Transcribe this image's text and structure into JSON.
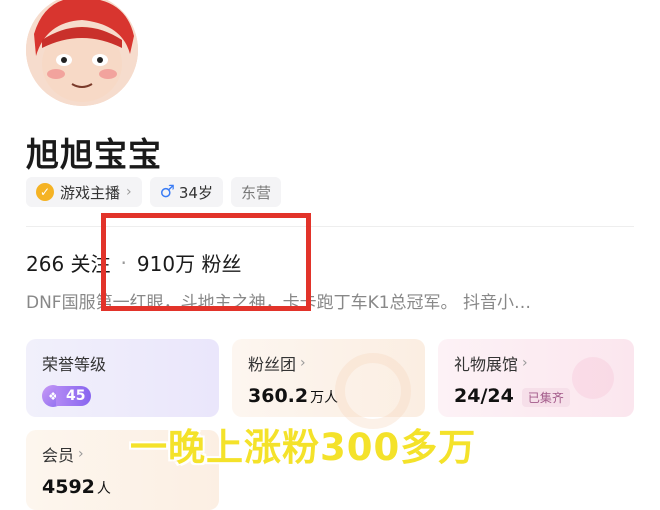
{
  "profile": {
    "name": "旭旭宝宝",
    "tags": {
      "role": "游戏主播",
      "gender_age": "34岁",
      "location": "东营"
    },
    "stats": {
      "following": "266",
      "following_label": "关注",
      "separator": "·",
      "fans": "910万",
      "fans_label": "粉丝"
    },
    "bio": "DNF国服第一红眼，斗地主之神，卡卡跑丁车K1总冠军。 抖音小…"
  },
  "cards": {
    "honor": {
      "title": "荣誉等级",
      "level": "45"
    },
    "fan_club": {
      "title": "粉丝团",
      "value": "360.2",
      "unit": "万人"
    },
    "gift_hall": {
      "title": "礼物展馆",
      "value": "24/24",
      "badge": "已集齐"
    },
    "member": {
      "title": "会员",
      "value": "4592",
      "unit": "人"
    }
  },
  "overlay_caption": "一晚上涨粉300多万",
  "colors": {
    "highlight_box": "#e2332a",
    "caption": "#f4e22a",
    "gold_badge": "#f5b324",
    "male_icon": "#3a7cf5"
  }
}
